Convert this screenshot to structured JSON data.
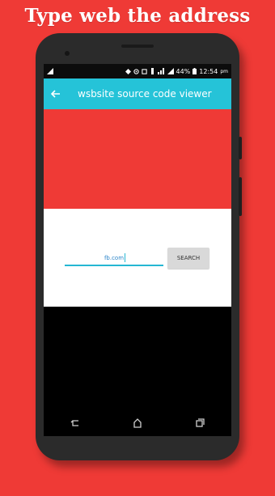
{
  "promo": {
    "title": "Type web the address"
  },
  "status_bar": {
    "battery": "44%",
    "time": "12:54",
    "period": "pm"
  },
  "app_bar": {
    "title": "wsbsite source code viewer"
  },
  "search": {
    "url_value": "fb.com",
    "button_label": "SEARCH"
  },
  "colors": {
    "background": "#ef3a36",
    "app_bar": "#25c3d8",
    "input_underline": "#25b7d3"
  },
  "icons": [
    "back-arrow-icon",
    "nav-back-icon",
    "nav-home-icon",
    "nav-recents-icon"
  ]
}
